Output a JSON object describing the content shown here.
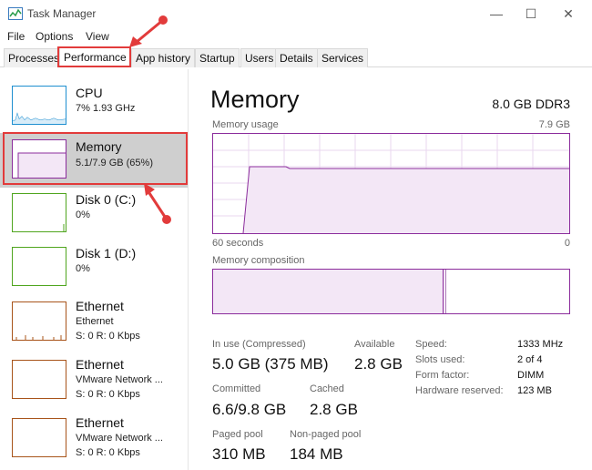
{
  "window": {
    "title": "Task Manager",
    "controls": {
      "minimize": "—",
      "maximize": "☐",
      "close": "✕"
    }
  },
  "menu": [
    "File",
    "Options",
    "View"
  ],
  "tabs": [
    "Processes",
    "Performance",
    "App history",
    "Startup",
    "Users",
    "Details",
    "Services"
  ],
  "active_tab": "Performance",
  "sidebar": {
    "items": [
      {
        "name": "CPU",
        "detail": "7% 1.93 GHz",
        "detail2": "",
        "color": "#1e8fd0",
        "selected": false
      },
      {
        "name": "Memory",
        "detail": "5.1/7.9 GB (65%)",
        "detail2": "",
        "color": "#8b2c9c",
        "selected": true
      },
      {
        "name": "Disk 0 (C:)",
        "detail": "0%",
        "detail2": "",
        "color": "#4fa51e",
        "selected": false
      },
      {
        "name": "Disk 1 (D:)",
        "detail": "0%",
        "detail2": "",
        "color": "#4fa51e",
        "selected": false
      },
      {
        "name": "Ethernet",
        "detail": "Ethernet",
        "detail2": "S: 0 R: 0 Kbps",
        "color": "#a8541a",
        "selected": false
      },
      {
        "name": "Ethernet",
        "detail": "VMware Network ...",
        "detail2": "S: 0 R: 0 Kbps",
        "color": "#a8541a",
        "selected": false
      },
      {
        "name": "Ethernet",
        "detail": "VMware Network ...",
        "detail2": "S: 0 R: 0 Kbps",
        "color": "#a8541a",
        "selected": false
      }
    ]
  },
  "main": {
    "title": "Memory",
    "spec": "8.0 GB DDR3",
    "usage_label": "Memory usage",
    "usage_max": "7.9 GB",
    "time_left": "60 seconds",
    "time_right": "0",
    "composition_label": "Memory composition",
    "stats": {
      "in_use_label": "In use (Compressed)",
      "in_use_value": "5.0 GB (375 MB)",
      "available_label": "Available",
      "available_value": "2.8 GB",
      "committed_label": "Committed",
      "committed_value": "6.6/9.8 GB",
      "cached_label": "Cached",
      "cached_value": "2.8 GB",
      "paged_label": "Paged pool",
      "paged_value": "310 MB",
      "nonpaged_label": "Non-paged pool",
      "nonpaged_value": "184 MB"
    },
    "specs": [
      {
        "label": "Speed:",
        "value": "1333 MHz"
      },
      {
        "label": "Slots used:",
        "value": "2 of 4"
      },
      {
        "label": "Form factor:",
        "value": "DIMM"
      },
      {
        "label": "Hardware reserved:",
        "value": "123 MB"
      }
    ]
  },
  "colors": {
    "accent_memory": "#8b2c9c",
    "annotation": "#e23b3b"
  }
}
